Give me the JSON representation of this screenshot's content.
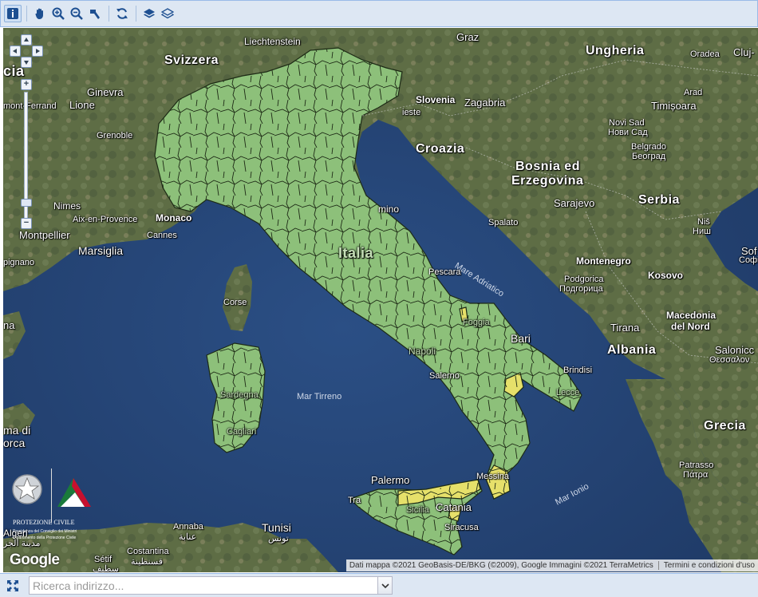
{
  "toolbar": {
    "buttons": [
      {
        "name": "info-button",
        "icon": "info-icon"
      },
      {
        "name": "pan-button",
        "icon": "hand-icon"
      },
      {
        "name": "zoom-in-button",
        "icon": "zoom-in-icon"
      },
      {
        "name": "zoom-out-button",
        "icon": "zoom-out-icon"
      },
      {
        "name": "measure-button",
        "icon": "measure-icon"
      },
      {
        "name": "refresh-button",
        "icon": "refresh-icon"
      },
      {
        "name": "layers-button",
        "icon": "layers-icon"
      },
      {
        "name": "layers-outline-button",
        "icon": "layers-outline-icon"
      }
    ]
  },
  "map": {
    "labels": {
      "liechtenstein": "Liechtenstein",
      "graz": "Graz",
      "ungheria": "Ungheria",
      "oradea": "Oradea",
      "cluj": "Cluj-",
      "svizzera": "Svizzera",
      "cia": "cia",
      "ginevra": "Ginevra",
      "lione": "Lione",
      "ferrand": "mont-Ferrand",
      "arad": "Arad",
      "timisoara": "Timișoara",
      "slovenia": "Slovenia",
      "zagabria": "Zagabria",
      "trieste": "ieste",
      "grenoble": "Grenoble",
      "novisad": "Novi Sad",
      "novisad_cyr": "Нови Сад",
      "croazia": "Croazia",
      "belgrado": "Belgrado",
      "belgrado_cyr": "Београд",
      "bosnia1": "Bosnia ed",
      "bosnia2": "Erzegovina",
      "sarajevo": "Sarajevo",
      "serbia": "Serbia",
      "rimino": "mino",
      "nimes": "Nimes",
      "aix": "Aix-en-Provence",
      "monaco": "Monaco",
      "cannes": "Cannes",
      "montpellier": "Montpellier",
      "spalato": "Spalato",
      "nis": "Niš",
      "nis_cyr": "Ниш",
      "sof": "Sof",
      "sof_cyr": "Софі",
      "marsiglia": "Marsiglia",
      "pignano": "pignano",
      "italia": "Italia",
      "mare_adriatico": "Mare Adriatico",
      "montenegro": "Montenegro",
      "pescara": "Pescara",
      "podgorica": "Podgorica",
      "podgorica_cyr": "Подгорица",
      "kosovo": "Kosovo",
      "corse": "Corse",
      "foggia": "Foggia",
      "na": "na",
      "tirana": "Tirana",
      "macedonia1": "Macedonia",
      "macedonia2": "del Nord",
      "bari": "Bari",
      "albania": "Albania",
      "salonicco": "Salonicc",
      "salonicco_gr": "Θεσσαλον",
      "napoli": "Napoli",
      "brindisi": "Brindisi",
      "lecce": "Lecce",
      "salerno": "Salerno",
      "mar_tirreno": "Mar Tirreno",
      "sardegna": "Sardegna",
      "cagliari": "Cagliari",
      "grecia": "Grecia",
      "maiorca1": "ma di",
      "maiorca2": "orca",
      "palermo": "Palermo",
      "messina": "Messina",
      "trapani": "Tra",
      "mar_ionio": "Mar Ionio",
      "patrasso": "Patrasso",
      "patrasso_gr": "Πάτρα",
      "catania": "Catania",
      "sicilia": "Sicilia",
      "siracusa": "Siracusa",
      "annaba": "Annaba",
      "annaba_ar": "عنابة",
      "tunisi": "Tunisi",
      "tunisi_ar": "تونس",
      "algeri": "Algeri",
      "algeri_ar": "مدينة الجز",
      "constantina": "Costantina",
      "constantina_ar": "قسنطينة",
      "setif": "Sétif",
      "setif_ar": "سطيف"
    },
    "attribution": "Dati mappa ©2021 GeoBasis-DE/BKG (©2009), Google Immagini ©2021 TerraMetrics",
    "terms": "Termini e condizioni d'uso",
    "google_logo": "Google",
    "agency_logo": "Dipartimento della Protezione Civile",
    "colors": {
      "region_fill": "#8dc07a",
      "region_alert": "#e6e06a",
      "sea": "#2c4a7a",
      "land": "#5f7046"
    }
  },
  "search": {
    "placeholder": "Ricerca indirizzo..."
  }
}
